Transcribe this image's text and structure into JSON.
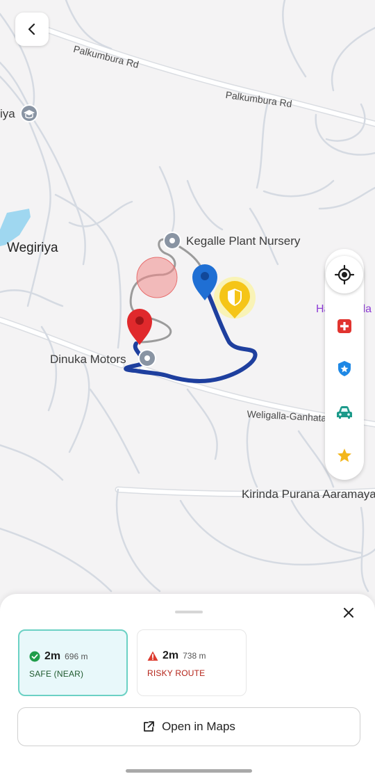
{
  "map": {
    "road_labels": {
      "palkumbura_1": "Palkumbura Rd",
      "palkumbura_2": "Palkumbura Rd",
      "weligalla": "Weligalla-Ganhata Rd"
    },
    "places": {
      "kegalle_nursery": "Kegalle Plant Nursery",
      "dinuka_motors": "Dinuka Motors",
      "wegiriya": "Wegiriya",
      "kirinda": "Kirinda Purana Aaramaya",
      "halu_gala": "Halun Gala",
      "iya": "iya"
    },
    "icons": {
      "destination": "red-pin-icon",
      "origin": "blue-pin-icon",
      "safe_zone": "yellow-shield-icon",
      "risk_zone": "red-circle"
    }
  },
  "colors": {
    "route_safe": "#1e3f9e",
    "route_risky": "#8f8f8f",
    "risk_zone": "#f08a8a",
    "accent_teal": "#6bd1c4",
    "safe_text": "#1f7a38",
    "risky_text": "#b42318"
  },
  "side_panel": {
    "buttons": [
      "locate-icon",
      "hospital-icon",
      "police-icon",
      "car-icon",
      "star-icon"
    ]
  },
  "sheet": {
    "routes": [
      {
        "time": "2m",
        "distance": "696 m",
        "status": "SAFE (NEAR)",
        "icon": "check-circle-icon",
        "selected": true
      },
      {
        "time": "2m",
        "distance": "738 m",
        "status": "RISKY ROUTE",
        "icon": "warning-icon",
        "selected": false
      }
    ],
    "open_maps_label": "Open in Maps"
  }
}
